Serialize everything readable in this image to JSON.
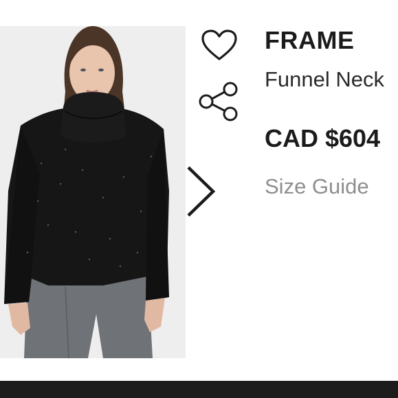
{
  "product": {
    "brand": "FRAME",
    "name": "Funnel Neck",
    "price": "CAD $604",
    "size_guide_label": "Size Guide"
  },
  "icons": {
    "wishlist": "heart-icon",
    "share": "share-icon",
    "next": "chevron-right-icon"
  },
  "colors": {
    "text_primary": "#1b1b1b",
    "text_muted": "#8e8e8e",
    "bottom_bar": "#1c1c1c"
  }
}
